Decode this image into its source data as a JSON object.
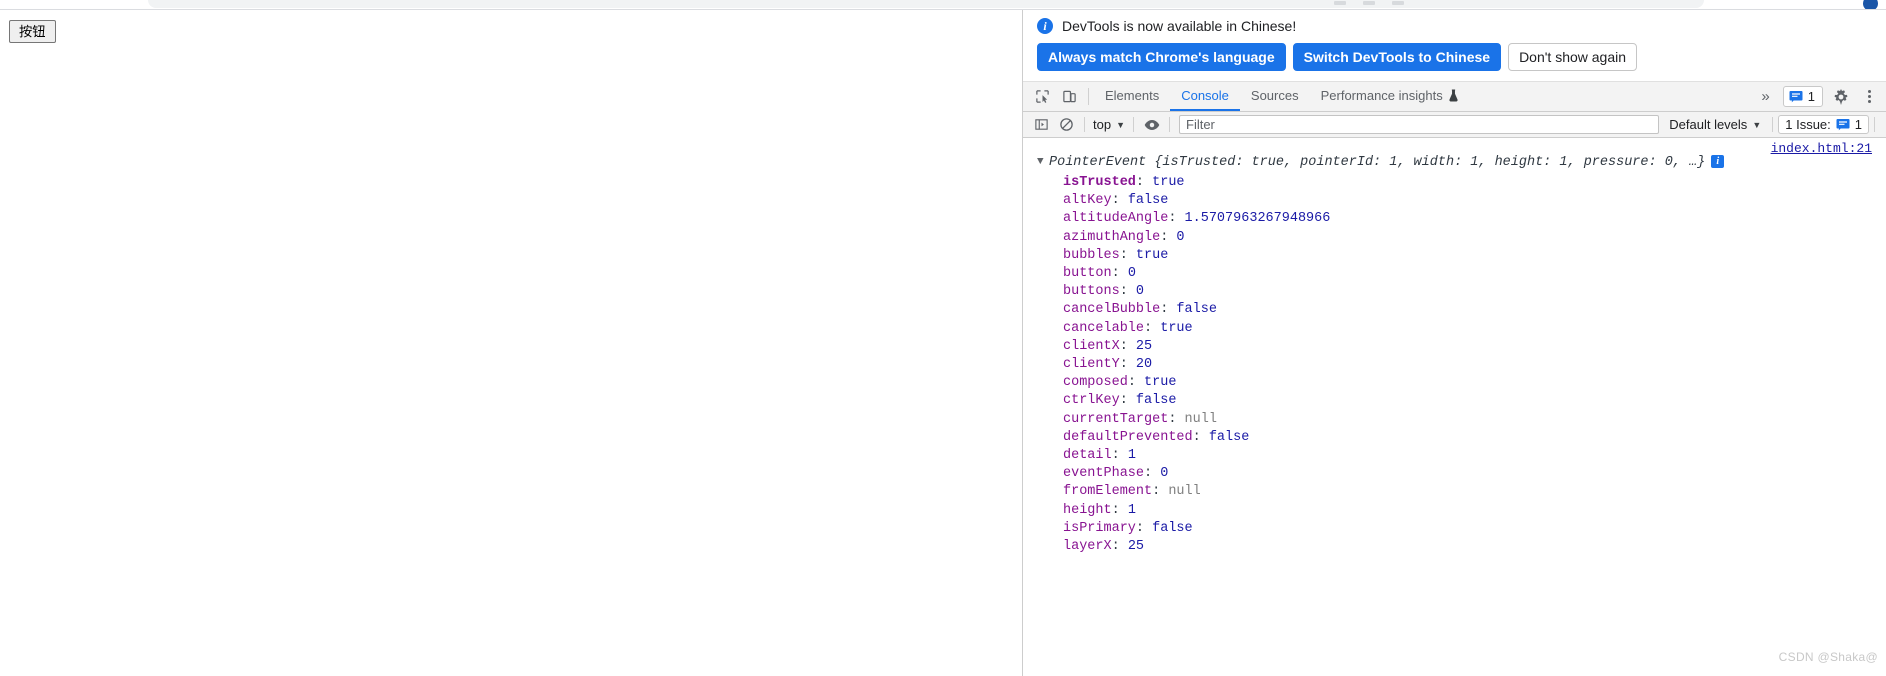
{
  "page": {
    "button_label": "按钮"
  },
  "devtools": {
    "infobar": {
      "icon": "info-icon",
      "message": "DevTools is now available in Chinese!",
      "always_match_label": "Always match Chrome's language",
      "switch_label": "Switch DevTools to Chinese",
      "dismiss_label": "Don't show again"
    },
    "tabbar": {
      "inspect_icon": "inspect-cursor-icon",
      "device_toggle_icon": "device-toolbar-icon",
      "tabs": [
        {
          "label": "Elements",
          "active": false
        },
        {
          "label": "Console",
          "active": true
        },
        {
          "label": "Sources",
          "active": false
        },
        {
          "label": "Performance insights",
          "active": false,
          "icon": "flask-icon"
        }
      ],
      "more_tabs_icon": "chevron-double-right-icon",
      "issues_badge": {
        "icon": "issue-message-icon",
        "count": "1"
      },
      "settings_icon": "gear-icon",
      "menu_icon": "kebab-menu-icon"
    },
    "console_toolbar": {
      "sidebar_icon": "console-sidebar-icon",
      "clear_icon": "clear-console-icon",
      "context": "top",
      "context_caret": "▼",
      "eye_icon": "live-expression-eye-icon",
      "filter_placeholder": "Filter",
      "filter_value": "",
      "levels_label": "Default levels",
      "levels_caret": "▼",
      "issue_label": "1 Issue:",
      "issue_icon": "issue-message-icon",
      "issue_count": "1"
    },
    "console_output": {
      "source_link": "index.html:21",
      "disclosure": "▼",
      "object_name": "PointerEvent",
      "preview": " {isTrusted: true, pointerId: 1, width: 1, height: 1, pressure: 0, …}",
      "info_badge": "i",
      "properties": [
        {
          "name": "isTrusted",
          "value": "true",
          "type": "bool",
          "own": true
        },
        {
          "name": "altKey",
          "value": "false",
          "type": "bool"
        },
        {
          "name": "altitudeAngle",
          "value": "1.5707963267948966",
          "type": "num"
        },
        {
          "name": "azimuthAngle",
          "value": "0",
          "type": "num"
        },
        {
          "name": "bubbles",
          "value": "true",
          "type": "bool"
        },
        {
          "name": "button",
          "value": "0",
          "type": "num"
        },
        {
          "name": "buttons",
          "value": "0",
          "type": "num"
        },
        {
          "name": "cancelBubble",
          "value": "false",
          "type": "bool"
        },
        {
          "name": "cancelable",
          "value": "true",
          "type": "bool"
        },
        {
          "name": "clientX",
          "value": "25",
          "type": "num"
        },
        {
          "name": "clientY",
          "value": "20",
          "type": "num"
        },
        {
          "name": "composed",
          "value": "true",
          "type": "bool"
        },
        {
          "name": "ctrlKey",
          "value": "false",
          "type": "bool"
        },
        {
          "name": "currentTarget",
          "value": "null",
          "type": "null"
        },
        {
          "name": "defaultPrevented",
          "value": "false",
          "type": "bool"
        },
        {
          "name": "detail",
          "value": "1",
          "type": "num"
        },
        {
          "name": "eventPhase",
          "value": "0",
          "type": "num"
        },
        {
          "name": "fromElement",
          "value": "null",
          "type": "null"
        },
        {
          "name": "height",
          "value": "1",
          "type": "num"
        },
        {
          "name": "isPrimary",
          "value": "false",
          "type": "bool"
        },
        {
          "name": "layerX",
          "value": "25",
          "type": "num"
        }
      ]
    },
    "watermark": "CSDN @Shaka@"
  }
}
